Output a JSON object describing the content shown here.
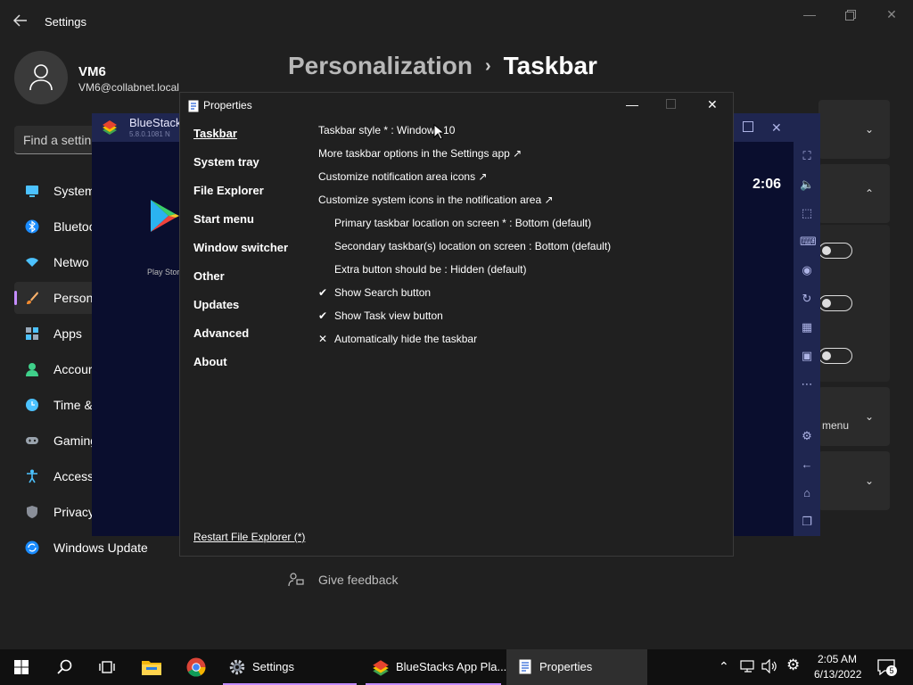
{
  "settings": {
    "app_title": "Settings",
    "user_name": "VM6",
    "user_email": "VM6@collabnet.local",
    "search_placeholder": "Find a settin",
    "nav": [
      {
        "label": "System",
        "icon": "monitor-icon"
      },
      {
        "label": "Bluetoo",
        "icon": "bluetooth-icon"
      },
      {
        "label": "Netwo",
        "icon": "wifi-icon"
      },
      {
        "label": "Person",
        "icon": "brush-icon"
      },
      {
        "label": "Apps",
        "icon": "apps-icon"
      },
      {
        "label": "Accour",
        "icon": "account-icon"
      },
      {
        "label": "Time &",
        "icon": "clock-icon"
      },
      {
        "label": "Gaming",
        "icon": "gamepad-icon"
      },
      {
        "label": "Access",
        "icon": "accessibility-icon"
      },
      {
        "label": "Privacy",
        "icon": "shield-icon"
      },
      {
        "label": "Windows Update",
        "icon": "update-icon"
      }
    ],
    "breadcrumb_parent": "Personalization",
    "breadcrumb_sep": "›",
    "page_title": "Taskbar",
    "menu_text": "menu",
    "feedback_label": "Give feedback",
    "accent_color": "#c48cff"
  },
  "bluestacks": {
    "title": "BlueStack",
    "version": "5.8.0.1081 N",
    "time": "2:06",
    "play_store_label": "Play Stor"
  },
  "properties": {
    "title": "Properties",
    "sidebar": [
      "Taskbar",
      "System tray",
      "File Explorer",
      "Start menu",
      "Window switcher",
      "Other",
      "Updates",
      "Advanced",
      "About"
    ],
    "options": [
      {
        "text": "Taskbar style * : Windows 10",
        "mark": ""
      },
      {
        "text": "More taskbar options in the Settings app ↗",
        "mark": ""
      },
      {
        "text": "Customize notification area icons ↗",
        "mark": ""
      },
      {
        "text": "Customize system icons in the notification area ↗",
        "mark": ""
      },
      {
        "text": "Primary taskbar location on screen * : Bottom (default)",
        "mark": ""
      },
      {
        "text": "Secondary taskbar(s) location on screen : Bottom (default)",
        "mark": ""
      },
      {
        "text": "Extra button should be : Hidden (default)",
        "mark": ""
      },
      {
        "text": "Show Search button",
        "mark": "✔"
      },
      {
        "text": "Show Task view button",
        "mark": "✔"
      },
      {
        "text": "Automatically hide the taskbar",
        "mark": "✕"
      }
    ],
    "restart_link": "Restart File Explorer (*)"
  },
  "taskbar": {
    "apps": [
      {
        "label": "Settings",
        "icon": "gear-icon"
      },
      {
        "label": "BlueStacks App Pla...",
        "icon": "bluestacks-icon"
      },
      {
        "label": "Properties",
        "icon": "properties-icon"
      }
    ],
    "clock_time": "2:05 AM",
    "clock_date": "6/13/2022",
    "notification_count": "5"
  }
}
